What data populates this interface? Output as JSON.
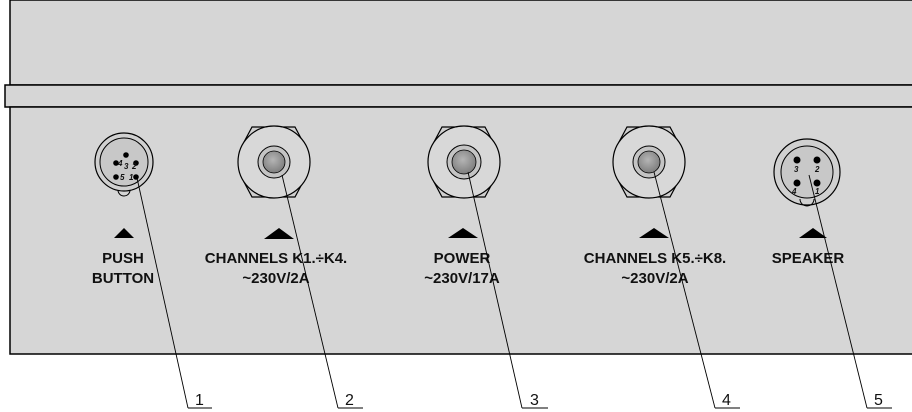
{
  "connectors": [
    {
      "label_lines": [
        "PUSH",
        "BUTTON"
      ],
      "number": "1",
      "pins": [
        "4",
        "3",
        "2",
        "5",
        "1"
      ]
    },
    {
      "label_lines": [
        "CHANNELS K1.÷K4.",
        "~230V/2A"
      ],
      "number": "2"
    },
    {
      "label_lines": [
        "POWER",
        "~230V/17A"
      ],
      "number": "3"
    },
    {
      "label_lines": [
        "CHANNELS K5.÷K8.",
        "~230V/2A"
      ],
      "number": "4"
    },
    {
      "label_lines": [
        "SPEAKER"
      ],
      "number": "5",
      "pins": [
        "3",
        "2",
        "4",
        "1"
      ]
    }
  ]
}
